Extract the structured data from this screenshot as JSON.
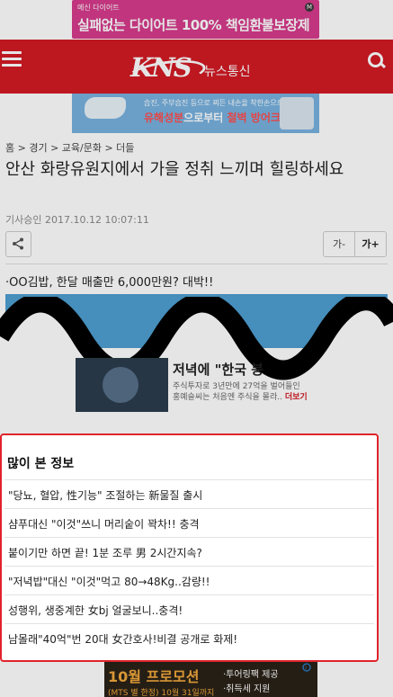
{
  "top_ad": {
    "small": "메신 다이어트",
    "main": "실패없는 다이어트 100% 책임환불보장제",
    "badge": "M"
  },
  "header": {
    "logo_text": "KNS",
    "brand": "뉴스통신"
  },
  "ad2": {
    "line1": "습진, 주부습진 등으로 찌든 내손을 착한손으로 거~땡!",
    "line2_prefix": "유해성분",
    "line2_rest": "으로부터 ",
    "line2_highlight": "철벽 방어크림"
  },
  "breadcrumb": "홈 > 경기 > 교육/문화 > 더들",
  "headline": "안산 화랑유원지에서 가을 정취 느끼며 힐링하세요",
  "meta": "기사승인 2017.10.12  10:07:11",
  "font_controls": {
    "minus": "가-",
    "plus": "가+"
  },
  "promo": "·OO김밥, 한달 매출만 6,000만원? 대박!!",
  "mid_ad": {
    "title": "저녁에 \"한국 붕",
    "desc1": "주식투자로 3년만에 27억을 벌어들인",
    "desc2": "홍예슬씨는 처음엔 주식을 몰라..",
    "more": "더보기"
  },
  "popular": {
    "title": "많이 본 정보",
    "items": [
      "\"당뇨, 혈압, 性기능\" 조절하는 新물질 출시",
      "샴푸대신 \"이것\"쓰니 머리숱이 꽉차!! 충격",
      "붙이기만 하면 끝! 1분 조루 男 2시간지속?",
      "\"저녁밥\"대신 \"이것\"먹고 80→48Kg..감량!!",
      "성행위, 생중계한 女bj 얼굴보니..충격!",
      "남몰래\"40억\"번 20대 女간호사!비결 공개로 화제!"
    ]
  },
  "bottom_ad": {
    "headline": "10월 프로모션",
    "sub": "(MTS 별 한정) 10월 31일까지",
    "f1": "·투어링팩 제공",
    "f2": "·취득세 지원"
  },
  "colors": {
    "brand_red": "#d31a24",
    "panel_border": "#e0232b"
  }
}
